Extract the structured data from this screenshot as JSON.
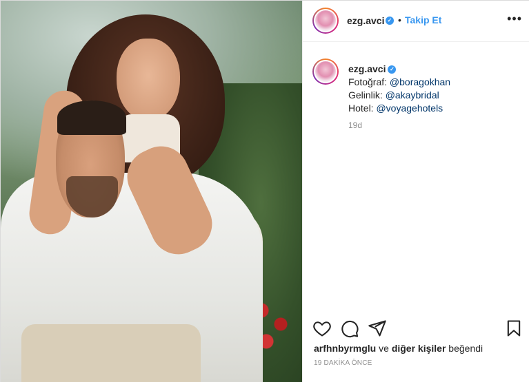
{
  "post": {
    "username": "ezg.avci",
    "follow_label": "Takip Et",
    "separator": "•",
    "more_label": "•••",
    "verified_icon": "verified-check-icon",
    "caption": {
      "emoji_row": "",
      "photographer_label": "Fotoğraf:",
      "photographer_handle": "@boragokhan",
      "dress_label": "Gelinlik:",
      "dress_handle": "@akaybridal",
      "hotel_label": "Hotel:",
      "hotel_handle": "@voyagehotels"
    },
    "caption_age": "19d",
    "likes": {
      "first_liker": "arfhnbyrmglu",
      "connector": "ve",
      "others": "diğer kişiler",
      "verb": "beğendi"
    },
    "posted_ago": "19 DAKİKA ÖNCE"
  },
  "icons": [
    "heart-icon",
    "comment-icon",
    "share-icon",
    "bookmark-icon"
  ],
  "colors": {
    "link_blue": "#3897f0",
    "text": "#262626",
    "muted": "#8e8e8e",
    "mention": "#003569"
  }
}
